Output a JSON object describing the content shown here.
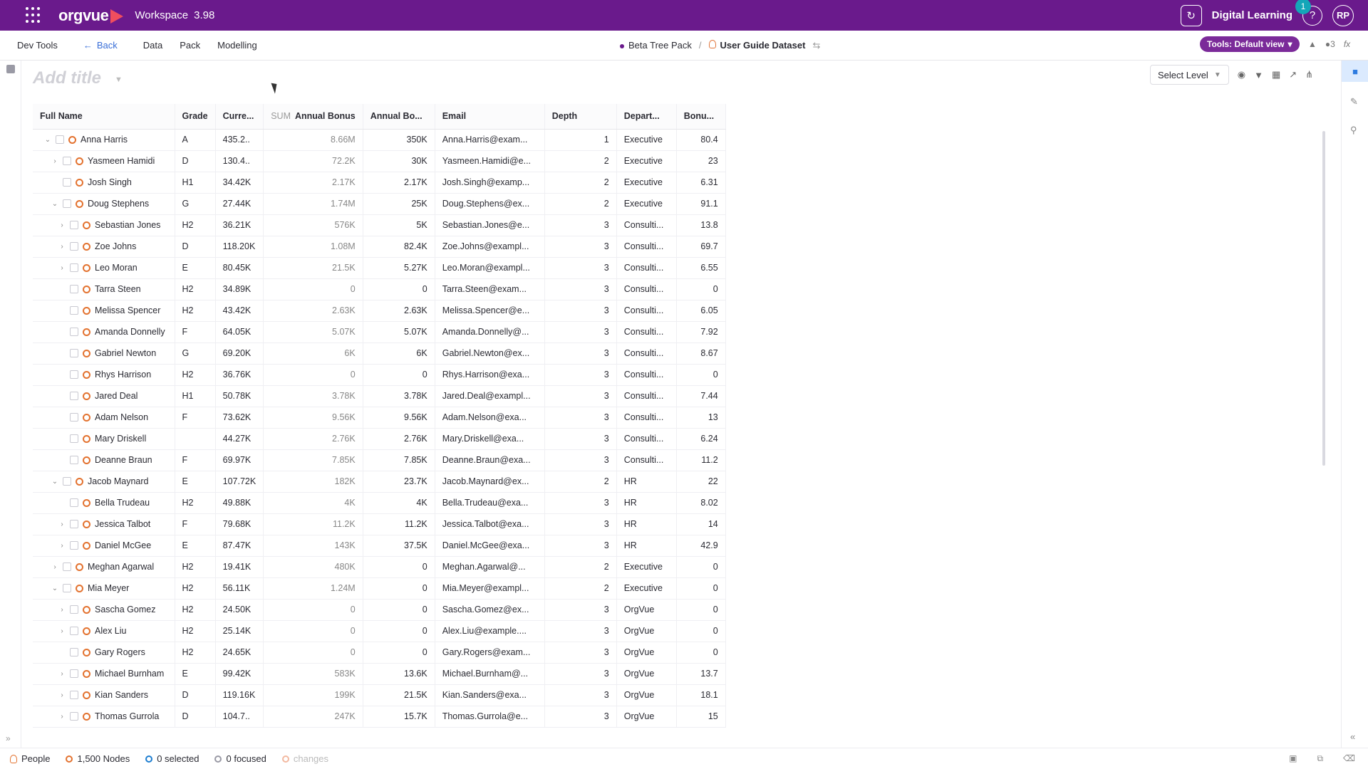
{
  "topbar": {
    "logo": "orgvue",
    "workspace_label": "Workspace",
    "version": "3.98",
    "org_name": "Digital Learning",
    "notification_count": "1",
    "help": "?",
    "avatar": "RP",
    "brand_color": "#6a1a8c"
  },
  "subnav": {
    "dev_tools": "Dev Tools",
    "back": "Back",
    "data": "Data",
    "pack": "Pack",
    "modelling": "Modelling",
    "breadcrumb_pack": "Beta Tree Pack",
    "breadcrumb_sep": "/",
    "breadcrumb_dataset": "User Guide Dataset",
    "tools_view": "Tools: Default view",
    "count": "3"
  },
  "title": {
    "placeholder": "Add title"
  },
  "toolbar": {
    "select_level": "Select Level"
  },
  "table": {
    "columns": [
      "Full Name",
      "Grade",
      "Curre...",
      "Annual Bonus",
      "Annual Bo...",
      "Email",
      "Depth",
      "Depart...",
      "Bonu..."
    ],
    "sum_label": "SUM",
    "rows": [
      {
        "expand": "v",
        "indent": 0,
        "name": "Anna Harris",
        "grade": "A",
        "current": "435.2..",
        "annual_bonus": "8.66M",
        "annual_bo": "350K",
        "email": "Anna.Harris@exam...",
        "depth": "1",
        "dept": "Executive",
        "bonus": "80.4"
      },
      {
        "expand": ">",
        "indent": 1,
        "name": "Yasmeen Hamidi",
        "grade": "D",
        "current": "130.4..",
        "annual_bonus": "72.2K",
        "annual_bo": "30K",
        "email": "Yasmeen.Hamidi@e...",
        "depth": "2",
        "dept": "Executive",
        "bonus": "23"
      },
      {
        "expand": "",
        "indent": 1,
        "name": "Josh Singh",
        "grade": "H1",
        "current": "34.42K",
        "annual_bonus": "2.17K",
        "annual_bo": "2.17K",
        "email": "Josh.Singh@examp...",
        "depth": "2",
        "dept": "Executive",
        "bonus": "6.31"
      },
      {
        "expand": "v",
        "indent": 1,
        "name": "Doug Stephens",
        "grade": "G",
        "current": "27.44K",
        "annual_bonus": "1.74M",
        "annual_bo": "25K",
        "email": "Doug.Stephens@ex...",
        "depth": "2",
        "dept": "Executive",
        "bonus": "91.1"
      },
      {
        "expand": ">",
        "indent": 2,
        "name": "Sebastian Jones",
        "grade": "H2",
        "current": "36.21K",
        "annual_bonus": "576K",
        "annual_bo": "5K",
        "email": "Sebastian.Jones@e...",
        "depth": "3",
        "dept": "Consulti...",
        "bonus": "13.8"
      },
      {
        "expand": ">",
        "indent": 2,
        "name": "Zoe Johns",
        "grade": "D",
        "current": "118.20K",
        "annual_bonus": "1.08M",
        "annual_bo": "82.4K",
        "email": "Zoe.Johns@exampl...",
        "depth": "3",
        "dept": "Consulti...",
        "bonus": "69.7"
      },
      {
        "expand": ">",
        "indent": 2,
        "name": "Leo Moran",
        "grade": "E",
        "current": "80.45K",
        "annual_bonus": "21.5K",
        "annual_bo": "5.27K",
        "email": "Leo.Moran@exampl...",
        "depth": "3",
        "dept": "Consulti...",
        "bonus": "6.55"
      },
      {
        "expand": "",
        "indent": 2,
        "name": "Tarra Steen",
        "grade": "H2",
        "current": "34.89K",
        "annual_bonus": "0",
        "annual_bo": "0",
        "email": "Tarra.Steen@exam...",
        "depth": "3",
        "dept": "Consulti...",
        "bonus": "0"
      },
      {
        "expand": "",
        "indent": 2,
        "name": "Melissa Spencer",
        "grade": "H2",
        "current": "43.42K",
        "annual_bonus": "2.63K",
        "annual_bo": "2.63K",
        "email": "Melissa.Spencer@e...",
        "depth": "3",
        "dept": "Consulti...",
        "bonus": "6.05"
      },
      {
        "expand": "",
        "indent": 2,
        "name": "Amanda Donnelly",
        "grade": "F",
        "current": "64.05K",
        "annual_bonus": "5.07K",
        "annual_bo": "5.07K",
        "email": "Amanda.Donnelly@...",
        "depth": "3",
        "dept": "Consulti...",
        "bonus": "7.92"
      },
      {
        "expand": "",
        "indent": 2,
        "name": "Gabriel Newton",
        "grade": "G",
        "current": "69.20K",
        "annual_bonus": "6K",
        "annual_bo": "6K",
        "email": "Gabriel.Newton@ex...",
        "depth": "3",
        "dept": "Consulti...",
        "bonus": "8.67"
      },
      {
        "expand": "",
        "indent": 2,
        "name": "Rhys Harrison",
        "grade": "H2",
        "current": "36.76K",
        "annual_bonus": "0",
        "annual_bo": "0",
        "email": "Rhys.Harrison@exa...",
        "depth": "3",
        "dept": "Consulti...",
        "bonus": "0"
      },
      {
        "expand": "",
        "indent": 2,
        "name": "Jared Deal",
        "grade": "H1",
        "current": "50.78K",
        "annual_bonus": "3.78K",
        "annual_bo": "3.78K",
        "email": "Jared.Deal@exampl...",
        "depth": "3",
        "dept": "Consulti...",
        "bonus": "7.44"
      },
      {
        "expand": "",
        "indent": 2,
        "name": "Adam Nelson",
        "grade": "F",
        "current": "73.62K",
        "annual_bonus": "9.56K",
        "annual_bo": "9.56K",
        "email": "Adam.Nelson@exa...",
        "depth": "3",
        "dept": "Consulti...",
        "bonus": "13"
      },
      {
        "expand": "",
        "indent": 2,
        "name": "Mary Driskell",
        "grade": "",
        "current": "44.27K",
        "annual_bonus": "2.76K",
        "annual_bo": "2.76K",
        "email": "Mary.Driskell@exa...",
        "depth": "3",
        "dept": "Consulti...",
        "bonus": "6.24"
      },
      {
        "expand": "",
        "indent": 2,
        "name": "Deanne Braun",
        "grade": "F",
        "current": "69.97K",
        "annual_bonus": "7.85K",
        "annual_bo": "7.85K",
        "email": "Deanne.Braun@exa...",
        "depth": "3",
        "dept": "Consulti...",
        "bonus": "11.2"
      },
      {
        "expand": "v",
        "indent": 1,
        "name": "Jacob Maynard",
        "grade": "E",
        "current": "107.72K",
        "annual_bonus": "182K",
        "annual_bo": "23.7K",
        "email": "Jacob.Maynard@ex...",
        "depth": "2",
        "dept": "HR",
        "bonus": "22"
      },
      {
        "expand": "",
        "indent": 2,
        "name": "Bella Trudeau",
        "grade": "H2",
        "current": "49.88K",
        "annual_bonus": "4K",
        "annual_bo": "4K",
        "email": "Bella.Trudeau@exa...",
        "depth": "3",
        "dept": "HR",
        "bonus": "8.02"
      },
      {
        "expand": ">",
        "indent": 2,
        "name": "Jessica Talbot",
        "grade": "F",
        "current": "79.68K",
        "annual_bonus": "11.2K",
        "annual_bo": "11.2K",
        "email": "Jessica.Talbot@exa...",
        "depth": "3",
        "dept": "HR",
        "bonus": "14"
      },
      {
        "expand": ">",
        "indent": 2,
        "name": "Daniel McGee",
        "grade": "E",
        "current": "87.47K",
        "annual_bonus": "143K",
        "annual_bo": "37.5K",
        "email": "Daniel.McGee@exa...",
        "depth": "3",
        "dept": "HR",
        "bonus": "42.9"
      },
      {
        "expand": ">",
        "indent": 1,
        "name": "Meghan Agarwal",
        "grade": "H2",
        "current": "19.41K",
        "annual_bonus": "480K",
        "annual_bo": "0",
        "email": "Meghan.Agarwal@...",
        "depth": "2",
        "dept": "Executive",
        "bonus": "0"
      },
      {
        "expand": "v",
        "indent": 1,
        "name": "Mia Meyer",
        "grade": "H2",
        "current": "56.11K",
        "annual_bonus": "1.24M",
        "annual_bo": "0",
        "email": "Mia.Meyer@exampl...",
        "depth": "2",
        "dept": "Executive",
        "bonus": "0"
      },
      {
        "expand": ">",
        "indent": 2,
        "name": "Sascha Gomez",
        "grade": "H2",
        "current": "24.50K",
        "annual_bonus": "0",
        "annual_bo": "0",
        "email": "Sascha.Gomez@ex...",
        "depth": "3",
        "dept": "OrgVue",
        "bonus": "0"
      },
      {
        "expand": ">",
        "indent": 2,
        "name": "Alex Liu",
        "grade": "H2",
        "current": "25.14K",
        "annual_bonus": "0",
        "annual_bo": "0",
        "email": "Alex.Liu@example....",
        "depth": "3",
        "dept": "OrgVue",
        "bonus": "0"
      },
      {
        "expand": "",
        "indent": 2,
        "name": "Gary Rogers",
        "grade": "H2",
        "current": "24.65K",
        "annual_bonus": "0",
        "annual_bo": "0",
        "email": "Gary.Rogers@exam...",
        "depth": "3",
        "dept": "OrgVue",
        "bonus": "0"
      },
      {
        "expand": ">",
        "indent": 2,
        "name": "Michael Burnham",
        "grade": "E",
        "current": "99.42K",
        "annual_bonus": "583K",
        "annual_bo": "13.6K",
        "email": "Michael.Burnham@...",
        "depth": "3",
        "dept": "OrgVue",
        "bonus": "13.7"
      },
      {
        "expand": ">",
        "indent": 2,
        "name": "Kian Sanders",
        "grade": "D",
        "current": "119.16K",
        "annual_bonus": "199K",
        "annual_bo": "21.5K",
        "email": "Kian.Sanders@exa...",
        "depth": "3",
        "dept": "OrgVue",
        "bonus": "18.1"
      },
      {
        "expand": ">",
        "indent": 2,
        "name": "Thomas Gurrola",
        "grade": "D",
        "current": "104.7..",
        "annual_bonus": "247K",
        "annual_bo": "15.7K",
        "email": "Thomas.Gurrola@e...",
        "depth": "3",
        "dept": "OrgVue",
        "bonus": "15"
      }
    ]
  },
  "statusbar": {
    "dataset": "People",
    "nodes": "1,500 Nodes",
    "selected": "0 selected",
    "focused": "0 focused",
    "changes": "changes"
  }
}
